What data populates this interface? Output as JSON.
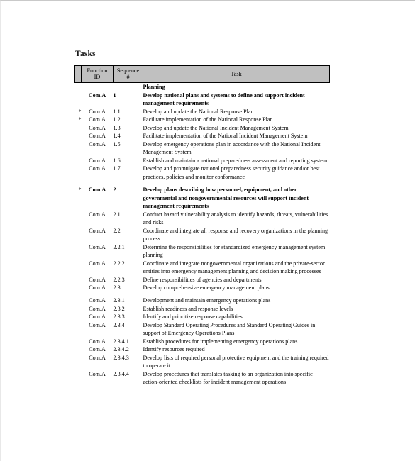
{
  "document": {
    "title": "Tasks"
  },
  "table": {
    "columns": [
      {
        "key": "mark",
        "label": ""
      },
      {
        "key": "function_id",
        "label": "Function ID"
      },
      {
        "key": "sequence",
        "label": "Sequence #"
      },
      {
        "key": "task",
        "label": "Task"
      }
    ],
    "header": {
      "marker": "",
      "function_id_line1": "Function",
      "function_id_line2": "ID",
      "sequence_line1": "Sequence",
      "sequence_line2": "#",
      "task": "Task"
    },
    "rows": [
      {
        "marker": "",
        "function_id": "",
        "sequence": "",
        "task": "Planning",
        "bold": true,
        "indent": 0,
        "spacer_before": false
      },
      {
        "marker": "",
        "function_id": "Com.A",
        "sequence": "1",
        "task": "Develop national plans and systems to define and support incident management requirements",
        "bold": true,
        "indent": 0,
        "spacer_before": false
      },
      {
        "marker": "*",
        "function_id": "Com.A",
        "sequence": "1.1",
        "task": "Develop and update the National Response Plan",
        "bold": false,
        "indent": 1,
        "spacer_before": false
      },
      {
        "marker": "*",
        "function_id": "Com.A",
        "sequence": "1.2",
        "task": "Facilitate implementation of the National Response Plan",
        "bold": false,
        "indent": 1,
        "spacer_before": false
      },
      {
        "marker": "",
        "function_id": "Com.A",
        "sequence": "1.3",
        "task": "Develop and update the National Incident Management System",
        "bold": false,
        "indent": 1,
        "spacer_before": false
      },
      {
        "marker": "",
        "function_id": "Com.A",
        "sequence": "1.4",
        "task": "Facilitate implementation of the National Incident Management System",
        "bold": false,
        "indent": 1,
        "spacer_before": false
      },
      {
        "marker": "",
        "function_id": "Com.A",
        "sequence": "1.5",
        "task": "Develop emergency operations plan in accordance with the National Incident Management System",
        "bold": false,
        "indent": 1,
        "spacer_before": false
      },
      {
        "marker": "",
        "function_id": "Com.A",
        "sequence": "1.6",
        "task": "Establish and maintain a national preparedness assessment and reporting system",
        "bold": false,
        "indent": 1,
        "spacer_before": false
      },
      {
        "marker": "",
        "function_id": "Com.A",
        "sequence": "1.7",
        "task": "Develop and promulgate national preparedness security guidance and/or best practices, policies and monitor conformance",
        "bold": false,
        "indent": 1,
        "spacer_before": false
      },
      {
        "marker": "*",
        "function_id": "Com.A",
        "sequence": "2",
        "task": "Develop plans describing how personnel, equipment, and other governmental and nongovernmental resources will support incident management requirements",
        "bold": true,
        "indent": 0,
        "spacer_before": true
      },
      {
        "marker": "",
        "function_id": "Com.A",
        "sequence": "2.1",
        "task": "Conduct hazard vulnerability analysis to identify hazards, threats, vulnerabilities and risks",
        "bold": false,
        "indent": 1,
        "spacer_before": false
      },
      {
        "marker": "",
        "function_id": "Com.A",
        "sequence": "2.2",
        "task": "Coordinate and integrate all response and recovery organizations in the planning process",
        "bold": false,
        "indent": 1,
        "spacer_before": false
      },
      {
        "marker": "",
        "function_id": "Com.A",
        "sequence": "2.2.1",
        "task": "Determine the responsibilities for standardized emergency management system planning",
        "bold": false,
        "indent": 4,
        "spacer_before": false
      },
      {
        "marker": "",
        "function_id": "Com.A",
        "sequence": "2.2.2",
        "task": "Coordinate and integrate nongovernmental organizations and the private-sector entities into emergency management planning and decision making processes",
        "bold": false,
        "indent": 4,
        "spacer_before": false
      },
      {
        "marker": "",
        "function_id": "Com.A",
        "sequence": "2.2.3",
        "task": "Define responsibilities of agencies and departments",
        "bold": false,
        "indent": 4,
        "spacer_before": false
      },
      {
        "marker": "",
        "function_id": "Com.A",
        "sequence": "2.3",
        "task": "Develop comprehensive emergency management plans",
        "bold": false,
        "indent": 2,
        "spacer_before": false
      },
      {
        "marker": "",
        "function_id": "Com.A",
        "sequence": "2.3.1",
        "task": "Development and maintain emergency operations plans",
        "bold": false,
        "indent": 5,
        "spacer_before": true
      },
      {
        "marker": "",
        "function_id": "Com.A",
        "sequence": "2.3.2",
        "task": "Establish readiness and response levels",
        "bold": false,
        "indent": 5,
        "spacer_before": false
      },
      {
        "marker": "",
        "function_id": "Com.A",
        "sequence": "2.3.3",
        "task": "Identify and prioritize response capabilities",
        "bold": false,
        "indent": 5,
        "spacer_before": false
      },
      {
        "marker": "",
        "function_id": "Com.A",
        "sequence": "2.3.4",
        "task": "Develop Standard Operating Procedures and Standard Operating Guides in support of Emergency Operations Plans",
        "bold": false,
        "indent": 5,
        "spacer_before": false
      },
      {
        "marker": "",
        "function_id": "Com.A",
        "sequence": "2.3.4.1",
        "task": "Establish procedures for implementing emergency operations plans",
        "bold": false,
        "indent": 3,
        "spacer_before": false
      },
      {
        "marker": "",
        "function_id": "Com.A",
        "sequence": "2.3.4.2",
        "task": "Identify resources required",
        "bold": false,
        "indent": 3,
        "spacer_before": false
      },
      {
        "marker": "",
        "function_id": "Com.A",
        "sequence": "2.3.4.3",
        "task": "Develop lists of required personal protective equipment and the training required to operate it",
        "bold": false,
        "indent": 3,
        "spacer_before": false
      },
      {
        "marker": "",
        "function_id": "Com.A",
        "sequence": "2.3.4.4",
        "task": "Develop procedures that translates tasking to an organization into specific action-oriented checklists for incident management operations",
        "bold": false,
        "indent": 3,
        "spacer_before": false
      }
    ]
  }
}
